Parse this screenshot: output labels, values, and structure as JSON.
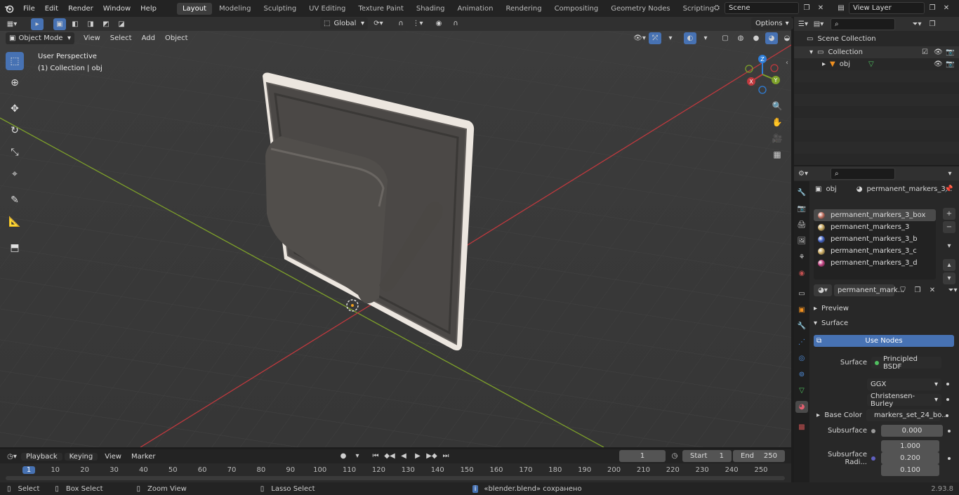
{
  "top_menu": [
    "File",
    "Edit",
    "Render",
    "Window",
    "Help"
  ],
  "workspaces": [
    "Layout",
    "Modeling",
    "Sculpting",
    "UV Editing",
    "Texture Paint",
    "Shading",
    "Animation",
    "Rendering",
    "Compositing",
    "Geometry Nodes",
    "Scripting"
  ],
  "active_workspace": "Layout",
  "scene": "Scene",
  "view_layer": "View Layer",
  "viewport_header": {
    "mode": "Object Mode",
    "menus": [
      "View",
      "Select",
      "Add",
      "Object"
    ],
    "transform_orientation": "Global",
    "options": "Options"
  },
  "viewport": {
    "perspective": "User Perspective",
    "collection_info": "(1) Collection | obj",
    "gizmo_axes": {
      "x": "X",
      "y": "Y",
      "z": "Z"
    }
  },
  "outliner": {
    "scene_collection": "Scene Collection",
    "collection": "Collection",
    "object": "obj"
  },
  "properties": {
    "object_name": "obj",
    "material_name_header": "permanent_markers_3...",
    "materials": [
      {
        "name": "permanent_markers_3_box",
        "color": "#c07060",
        "selected": true
      },
      {
        "name": "permanent_markers_3",
        "color": "#c8a860",
        "selected": false
      },
      {
        "name": "permanent_markers_3_b",
        "color": "#4060c0",
        "selected": false
      },
      {
        "name": "permanent_markers_3_c",
        "color": "#c8a860",
        "selected": false
      },
      {
        "name": "permanent_markers_3_d",
        "color": "#c04080",
        "selected": false
      }
    ],
    "active_material_field": "permanent_mark...",
    "preview_label": "Preview",
    "surface_label": "Surface",
    "use_nodes": "Use Nodes",
    "surface_field_label": "Surface",
    "surface_shader": "Principled BSDF",
    "distribution": "GGX",
    "subsurface_method": "Christensen-Burley",
    "base_color_label": "Base Color",
    "base_color_value": "markers_set_24_bo...",
    "subsurface_label": "Subsurface",
    "subsurface_value": "0.000",
    "subsurface_radius_label": "Subsurface Radi...",
    "subsurface_radius": [
      "1.000",
      "0.200",
      "0.100"
    ]
  },
  "timeline": {
    "menus": [
      "Playback",
      "Keying",
      "View",
      "Marker"
    ],
    "current_frame": "1",
    "start_label": "Start",
    "start": "1",
    "end_label": "End",
    "end": "250",
    "ticks": [
      "1",
      "10",
      "20",
      "30",
      "40",
      "50",
      "60",
      "70",
      "80",
      "90",
      "100",
      "110",
      "120",
      "130",
      "140",
      "150",
      "160",
      "170",
      "180",
      "190",
      "200",
      "210",
      "220",
      "230",
      "240",
      "250"
    ]
  },
  "status_bar": {
    "select": "Select",
    "box_select": "Box Select",
    "zoom_view": "Zoom View",
    "lasso_select": "Lasso Select",
    "message": "«blender.blend» сохранено",
    "version": "2.93.8"
  },
  "colors": {
    "accent": "#4772b3",
    "axis_x": "#c0393e",
    "axis_y": "#7ea12a",
    "axis_z": "#2f7ed8"
  }
}
